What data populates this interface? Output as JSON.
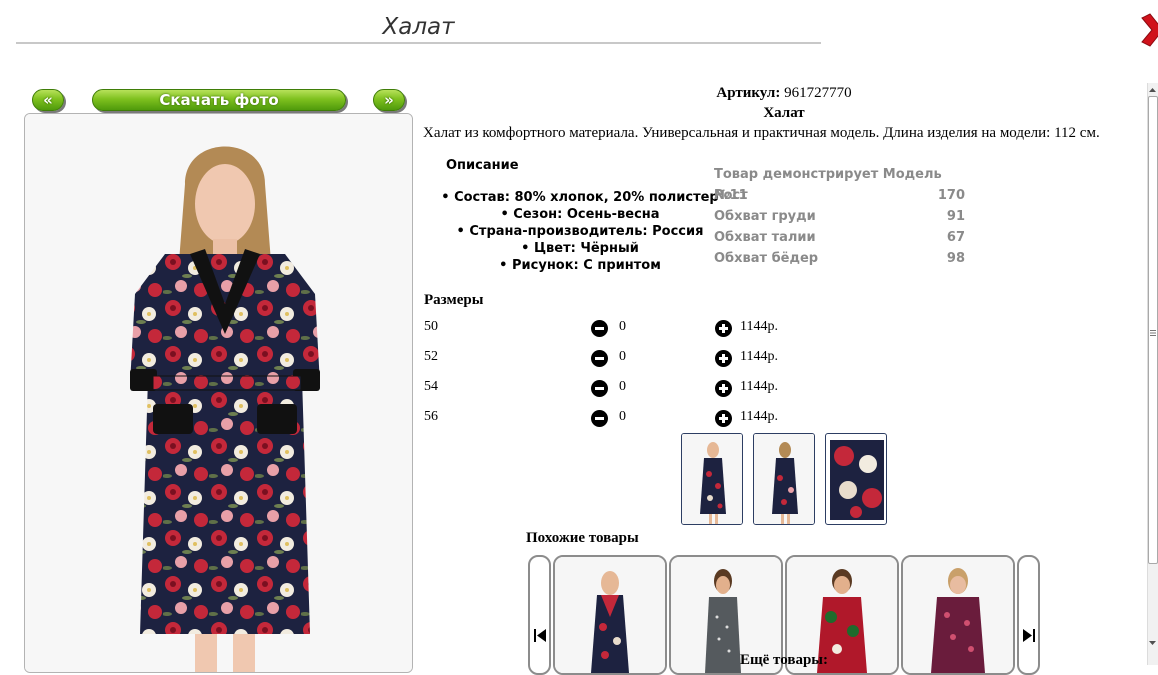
{
  "header": {
    "title": "Халат"
  },
  "nav": {
    "prev_label": "«",
    "download_label": "Скачать фото",
    "next_label": "»"
  },
  "product": {
    "article_label": "Артикул:",
    "article_value": "961727770",
    "name": "Халат",
    "description": "Халат из комфортного материала. Универсальная и практичная модель. Длина изделия на модели: 112 см."
  },
  "details": {
    "heading": "Описание",
    "specs": [
      "• Состав: 80% хлопок, 20% полистер",
      "• Сезон: Осень-весна",
      "• Страна-производитель: Россия",
      "• Цвет: Чёрный",
      "• Рисунок: С принтом"
    ]
  },
  "model": {
    "title": "Товар демонстрирует Модель №11",
    "rows": [
      {
        "label": "Рост",
        "value": "170"
      },
      {
        "label": "Обхват груди",
        "value": "91"
      },
      {
        "label": "Обхват талии",
        "value": "67"
      },
      {
        "label": "Обхват бёдер",
        "value": "98"
      }
    ]
  },
  "sizes": {
    "heading": "Размеры",
    "rows": [
      {
        "size": "50",
        "qty": "0",
        "price": "1144р."
      },
      {
        "size": "52",
        "qty": "0",
        "price": "1144р."
      },
      {
        "size": "54",
        "qty": "0",
        "price": "1144р."
      },
      {
        "size": "56",
        "qty": "0",
        "price": "1144р."
      }
    ]
  },
  "similar": {
    "heading": "Похожие товары"
  },
  "more": {
    "heading": "Ещё товары:"
  },
  "colors": {
    "button_green": "#7fc11f",
    "close_red": "#d0121b",
    "robe_navy": "#1d2240",
    "flower_red": "#c4283a"
  }
}
